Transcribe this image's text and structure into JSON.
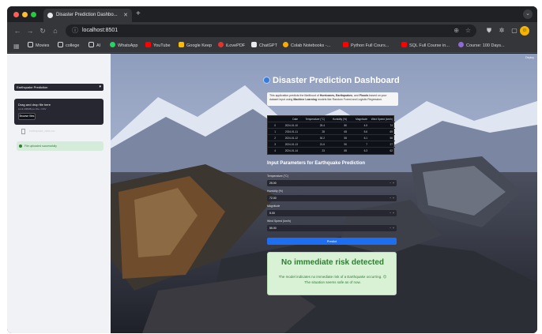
{
  "browser": {
    "tab_title": "Disaster Prediction Dashbo...",
    "url": "localhost:8501",
    "bookmarks": [
      "Movies",
      "college",
      "AI",
      "WhatsApp",
      "YouTube",
      "Google Keep",
      "iLovePDF",
      "ChatGPT",
      "Colab Notebooks -...",
      "Python Full Cours...",
      "SQL Full Course in...",
      "Course: 100 Days..."
    ]
  },
  "sidebar": {
    "disaster_select": "Earthquake Prediction",
    "upload_title": "Drag and drop file here",
    "upload_limit": "Limit 200MB per file • CSV",
    "browse_label": "Browse files",
    "file_name": "earthquake_data.csv",
    "success_message": "File uploaded successfully"
  },
  "main": {
    "deploy_label": "Deploy",
    "title": "Disaster Prediction Dashboard",
    "description_parts": [
      "This application predicts the likelihood of ",
      "Hurricanes, Earthquakes",
      ", and ",
      "Floods",
      " based on your dataset input using ",
      "Machine Learning",
      " models like Random Forest and Logistic Regression."
    ],
    "table": {
      "headers": [
        "",
        "Date",
        "Temperature (°C)",
        "Humidity (%)",
        "Magnitude",
        "Wind Speed (km/h)"
      ],
      "rows": [
        [
          "0",
          "2024-01-10",
          "25.4",
          "80",
          "4.5",
          "74"
        ],
        [
          "1",
          "2024-01-11",
          "28",
          "65",
          "5.6",
          "69"
        ],
        [
          "2",
          "2024-01-12",
          "30.2",
          "55",
          "6.1",
          "58"
        ],
        [
          "3",
          "2024-01-13",
          "21.6",
          "90",
          "7",
          "27"
        ],
        [
          "4",
          "2024-01-14",
          "23",
          "85",
          "6.3",
          "62"
        ]
      ]
    },
    "section_title": "Input Parameters for Earthquake Prediction",
    "inputs": [
      {
        "label": "Temperature (°C)",
        "value": "25.00"
      },
      {
        "label": "Humidity (%)",
        "value": "72.00"
      },
      {
        "label": "Magnitude",
        "value": "5.00"
      },
      {
        "label": "Wind Speed (km/h)",
        "value": "55.00"
      }
    ],
    "predict_label": "Predict",
    "result_title": "No immediate risk detected",
    "result_message": "The model indicates no immediate risk of a Earthquake occurring. 😊 The situation seems safe as of now."
  }
}
